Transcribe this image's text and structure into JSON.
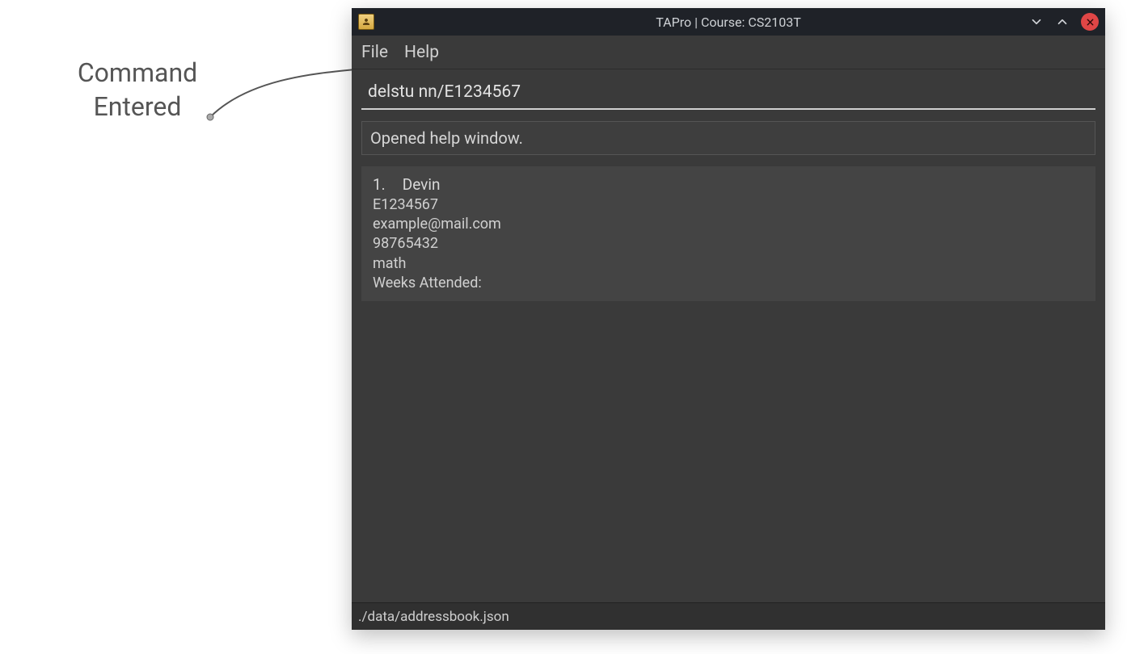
{
  "annotation": {
    "line1": "Command",
    "line2": "Entered"
  },
  "window": {
    "title": "TAPro | Course: CS2103T"
  },
  "menubar": {
    "file": "File",
    "help": "Help"
  },
  "command_input": {
    "value": "delstu nn/E1234567"
  },
  "result": {
    "message": "Opened help window."
  },
  "persons": [
    {
      "index": "1.",
      "name": "Devin",
      "id": "E1234567",
      "email": "example@mail.com",
      "phone": "98765432",
      "major": "math",
      "weeks_label": "Weeks Attended:"
    }
  ],
  "status": {
    "path": "./data/addressbook.json"
  }
}
